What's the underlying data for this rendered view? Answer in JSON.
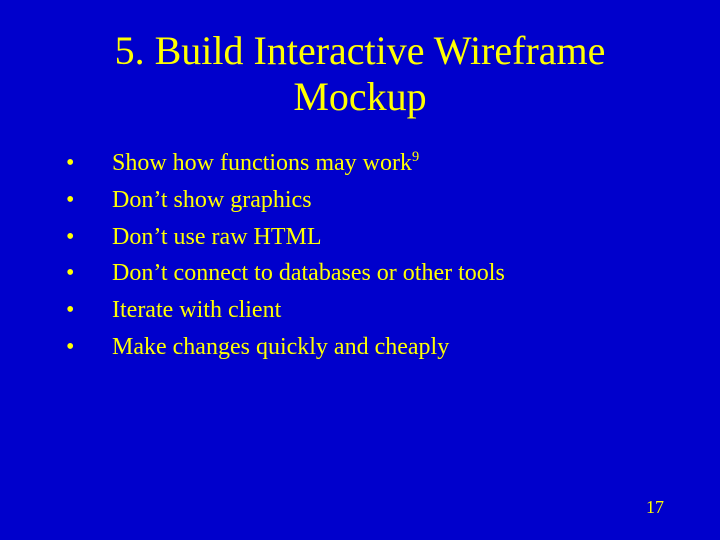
{
  "slide": {
    "title": "5. Build Interactive Wireframe Mockup",
    "bullets": [
      {
        "text": "Show how functions may work",
        "sup": "9"
      },
      {
        "text": "Don’t show graphics",
        "sup": ""
      },
      {
        "text": "Don’t use raw HTML",
        "sup": ""
      },
      {
        "text": "Don’t connect to databases or other tools",
        "sup": ""
      },
      {
        "text": "Iterate with client",
        "sup": ""
      },
      {
        "text": "Make changes quickly and cheaply",
        "sup": ""
      }
    ],
    "page_number": "17"
  }
}
